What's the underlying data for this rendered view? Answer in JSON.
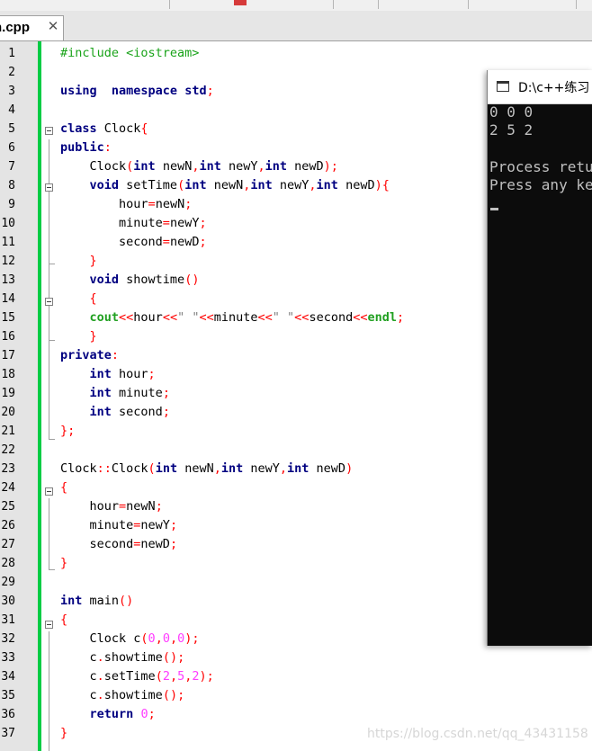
{
  "tab": {
    "filename": "n.cpp",
    "close_glyph": "✕"
  },
  "editor": {
    "lines": [
      {
        "n": "1",
        "t": [
          [
            "pp",
            "#include <iostream>"
          ]
        ]
      },
      {
        "n": "2",
        "t": []
      },
      {
        "n": "3",
        "t": [
          [
            "kw",
            "using"
          ],
          [
            "",
            "  "
          ],
          [
            "kw",
            "namespace"
          ],
          [
            "",
            " "
          ],
          [
            "kw",
            "std"
          ],
          [
            "pn",
            ";"
          ]
        ]
      },
      {
        "n": "4",
        "t": []
      },
      {
        "n": "5",
        "t": [
          [
            "kw",
            "class"
          ],
          [
            "",
            " Clock"
          ],
          [
            "pn",
            "{"
          ]
        ]
      },
      {
        "n": "6",
        "t": [
          [
            "kw",
            "public"
          ],
          [
            "pn",
            ":"
          ]
        ]
      },
      {
        "n": "7",
        "t": [
          [
            "",
            "    Clock"
          ],
          [
            "pn",
            "("
          ],
          [
            "kw",
            "int"
          ],
          [
            "",
            " newN"
          ],
          [
            "pn",
            ","
          ],
          [
            "kw",
            "int"
          ],
          [
            "",
            " newY"
          ],
          [
            "pn",
            ","
          ],
          [
            "kw",
            "int"
          ],
          [
            "",
            " newD"
          ],
          [
            "pn",
            ");"
          ]
        ]
      },
      {
        "n": "8",
        "t": [
          [
            "",
            "    "
          ],
          [
            "kw",
            "void"
          ],
          [
            "",
            " setTime"
          ],
          [
            "pn",
            "("
          ],
          [
            "kw",
            "int"
          ],
          [
            "",
            " newN"
          ],
          [
            "pn",
            ","
          ],
          [
            "kw",
            "int"
          ],
          [
            "",
            " newY"
          ],
          [
            "pn",
            ","
          ],
          [
            "kw",
            "int"
          ],
          [
            "",
            " newD"
          ],
          [
            "pn",
            "){"
          ]
        ]
      },
      {
        "n": "9",
        "t": [
          [
            "",
            "        hour"
          ],
          [
            "pn",
            "="
          ],
          [
            "",
            "newN"
          ],
          [
            "pn",
            ";"
          ]
        ]
      },
      {
        "n": "10",
        "t": [
          [
            "",
            "        minute"
          ],
          [
            "pn",
            "="
          ],
          [
            "",
            "newY"
          ],
          [
            "pn",
            ";"
          ]
        ]
      },
      {
        "n": "11",
        "t": [
          [
            "",
            "        second"
          ],
          [
            "pn",
            "="
          ],
          [
            "",
            "newD"
          ],
          [
            "pn",
            ";"
          ]
        ]
      },
      {
        "n": "12",
        "t": [
          [
            "",
            "    "
          ],
          [
            "pn",
            "}"
          ]
        ]
      },
      {
        "n": "13",
        "t": [
          [
            "",
            "    "
          ],
          [
            "kw",
            "void"
          ],
          [
            "",
            " showtime"
          ],
          [
            "pn",
            "()"
          ]
        ]
      },
      {
        "n": "14",
        "t": [
          [
            "",
            "    "
          ],
          [
            "pn",
            "{"
          ]
        ]
      },
      {
        "n": "15",
        "t": [
          [
            "",
            "    "
          ],
          [
            "cl",
            "cout"
          ],
          [
            "pn",
            "<<"
          ],
          [
            "",
            "hour"
          ],
          [
            "pn",
            "<<"
          ],
          [
            "st",
            "\" \""
          ],
          [
            "pn",
            "<<"
          ],
          [
            "",
            "minute"
          ],
          [
            "pn",
            "<<"
          ],
          [
            "st",
            "\" \""
          ],
          [
            "pn",
            "<<"
          ],
          [
            "",
            "second"
          ],
          [
            "pn",
            "<<"
          ],
          [
            "cl",
            "endl"
          ],
          [
            "pn",
            ";"
          ]
        ]
      },
      {
        "n": "16",
        "t": [
          [
            "",
            "    "
          ],
          [
            "pn",
            "}"
          ]
        ]
      },
      {
        "n": "17",
        "t": [
          [
            "kw",
            "private"
          ],
          [
            "pn",
            ":"
          ]
        ]
      },
      {
        "n": "18",
        "t": [
          [
            "",
            "    "
          ],
          [
            "kw",
            "int"
          ],
          [
            "",
            " hour"
          ],
          [
            "pn",
            ";"
          ]
        ]
      },
      {
        "n": "19",
        "t": [
          [
            "",
            "    "
          ],
          [
            "kw",
            "int"
          ],
          [
            "",
            " minute"
          ],
          [
            "pn",
            ";"
          ]
        ]
      },
      {
        "n": "20",
        "t": [
          [
            "",
            "    "
          ],
          [
            "kw",
            "int"
          ],
          [
            "",
            " second"
          ],
          [
            "pn",
            ";"
          ]
        ]
      },
      {
        "n": "21",
        "t": [
          [
            "pn",
            "};"
          ]
        ]
      },
      {
        "n": "22",
        "t": []
      },
      {
        "n": "23",
        "t": [
          [
            "",
            "Clock"
          ],
          [
            "pn",
            "::"
          ],
          [
            "",
            "Clock"
          ],
          [
            "pn",
            "("
          ],
          [
            "kw",
            "int"
          ],
          [
            "",
            " newN"
          ],
          [
            "pn",
            ","
          ],
          [
            "kw",
            "int"
          ],
          [
            "",
            " newY"
          ],
          [
            "pn",
            ","
          ],
          [
            "kw",
            "int"
          ],
          [
            "",
            " newD"
          ],
          [
            "pn",
            ")"
          ]
        ]
      },
      {
        "n": "24",
        "t": [
          [
            "pn",
            "{"
          ]
        ]
      },
      {
        "n": "25",
        "t": [
          [
            "",
            "    hour"
          ],
          [
            "pn",
            "="
          ],
          [
            "",
            "newN"
          ],
          [
            "pn",
            ";"
          ]
        ]
      },
      {
        "n": "26",
        "t": [
          [
            "",
            "    minute"
          ],
          [
            "pn",
            "="
          ],
          [
            "",
            "newY"
          ],
          [
            "pn",
            ";"
          ]
        ]
      },
      {
        "n": "27",
        "t": [
          [
            "",
            "    second"
          ],
          [
            "pn",
            "="
          ],
          [
            "",
            "newD"
          ],
          [
            "pn",
            ";"
          ]
        ]
      },
      {
        "n": "28",
        "t": [
          [
            "pn",
            "}"
          ]
        ]
      },
      {
        "n": "29",
        "t": []
      },
      {
        "n": "30",
        "t": [
          [
            "kw",
            "int"
          ],
          [
            "",
            " main"
          ],
          [
            "pn",
            "()"
          ]
        ]
      },
      {
        "n": "31",
        "t": [
          [
            "pn",
            "{"
          ]
        ]
      },
      {
        "n": "32",
        "t": [
          [
            "",
            "    Clock c"
          ],
          [
            "pn",
            "("
          ],
          [
            "nm",
            "0"
          ],
          [
            "pn",
            ","
          ],
          [
            "nm",
            "0"
          ],
          [
            "pn",
            ","
          ],
          [
            "nm",
            "0"
          ],
          [
            "pn",
            ");"
          ]
        ]
      },
      {
        "n": "33",
        "t": [
          [
            "",
            "    c"
          ],
          [
            "pn",
            "."
          ],
          [
            "",
            "showtime"
          ],
          [
            "pn",
            "();"
          ]
        ]
      },
      {
        "n": "34",
        "t": [
          [
            "",
            "    c"
          ],
          [
            "pn",
            "."
          ],
          [
            "",
            "setTime"
          ],
          [
            "pn",
            "("
          ],
          [
            "nm",
            "2"
          ],
          [
            "pn",
            ","
          ],
          [
            "nm",
            "5"
          ],
          [
            "pn",
            ","
          ],
          [
            "nm",
            "2"
          ],
          [
            "pn",
            ");"
          ]
        ]
      },
      {
        "n": "35",
        "t": [
          [
            "",
            "    c"
          ],
          [
            "pn",
            "."
          ],
          [
            "",
            "showtime"
          ],
          [
            "pn",
            "();"
          ]
        ]
      },
      {
        "n": "36",
        "t": [
          [
            "",
            "    "
          ],
          [
            "kw",
            "return"
          ],
          [
            "",
            " "
          ],
          [
            "nm",
            "0"
          ],
          [
            "pn",
            ";"
          ]
        ]
      },
      {
        "n": "37",
        "t": [
          [
            "pn",
            "}"
          ]
        ]
      }
    ]
  },
  "console": {
    "title": "D:\\c++练习",
    "output": [
      "0 0 0",
      "2 5 2",
      "",
      "Process retu",
      "Press any ke"
    ]
  },
  "watermark": "https://blog.csdn.net/qq_43431158",
  "colors": {
    "keyword": "#000080",
    "preprocessor": "#19a319",
    "punctuation": "#ff0000",
    "number": "#ff3cff",
    "string": "#808080",
    "change_bar": "#00cc44",
    "console_bg": "#0c0c0c"
  }
}
